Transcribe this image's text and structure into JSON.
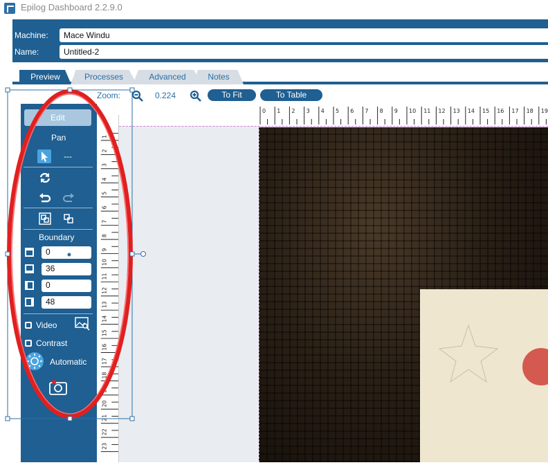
{
  "app": {
    "title": "Epilog Dashboard 2.2.9.0"
  },
  "header": {
    "machine_label": "Machine:",
    "machine_value": "Mace Windu",
    "name_label": "Name:",
    "name_value": "Untitled-2"
  },
  "tabs": [
    {
      "label": "Preview",
      "active": true
    },
    {
      "label": "Processes",
      "active": false
    },
    {
      "label": "Advanced",
      "active": false
    },
    {
      "label": "Notes",
      "active": false
    }
  ],
  "zoom": {
    "label": "Zoom:",
    "value": "0.224",
    "to_fit_label": "To Fit",
    "to_table_label": "To Table"
  },
  "left_panel": {
    "edit_label": "Edit",
    "pan_label": "Pan",
    "pointer_value": "---",
    "boundary_label": "Boundary",
    "boundary_values": [
      "0",
      "36",
      "0",
      "48"
    ],
    "video_label": "Video",
    "contrast_label": "Contrast",
    "automatic_label": "Automatic"
  },
  "rulers": {
    "horizontal": [
      "0",
      "1",
      "2",
      "3",
      "4",
      "5",
      "6",
      "7",
      "8",
      "9",
      "10",
      "11",
      "12",
      "13",
      "14",
      "15",
      "16",
      "17",
      "18",
      "19"
    ],
    "vertical": [
      "1",
      "2",
      "3",
      "4",
      "5",
      "6",
      "7",
      "8",
      "9",
      "10",
      "11",
      "12",
      "13",
      "14",
      "15",
      "16",
      "17",
      "18",
      "19",
      "20",
      "21",
      "22",
      "23"
    ]
  },
  "colors": {
    "accent": "#1f5f91",
    "annotation": "#e02020",
    "selection": "#2c6fa6"
  }
}
